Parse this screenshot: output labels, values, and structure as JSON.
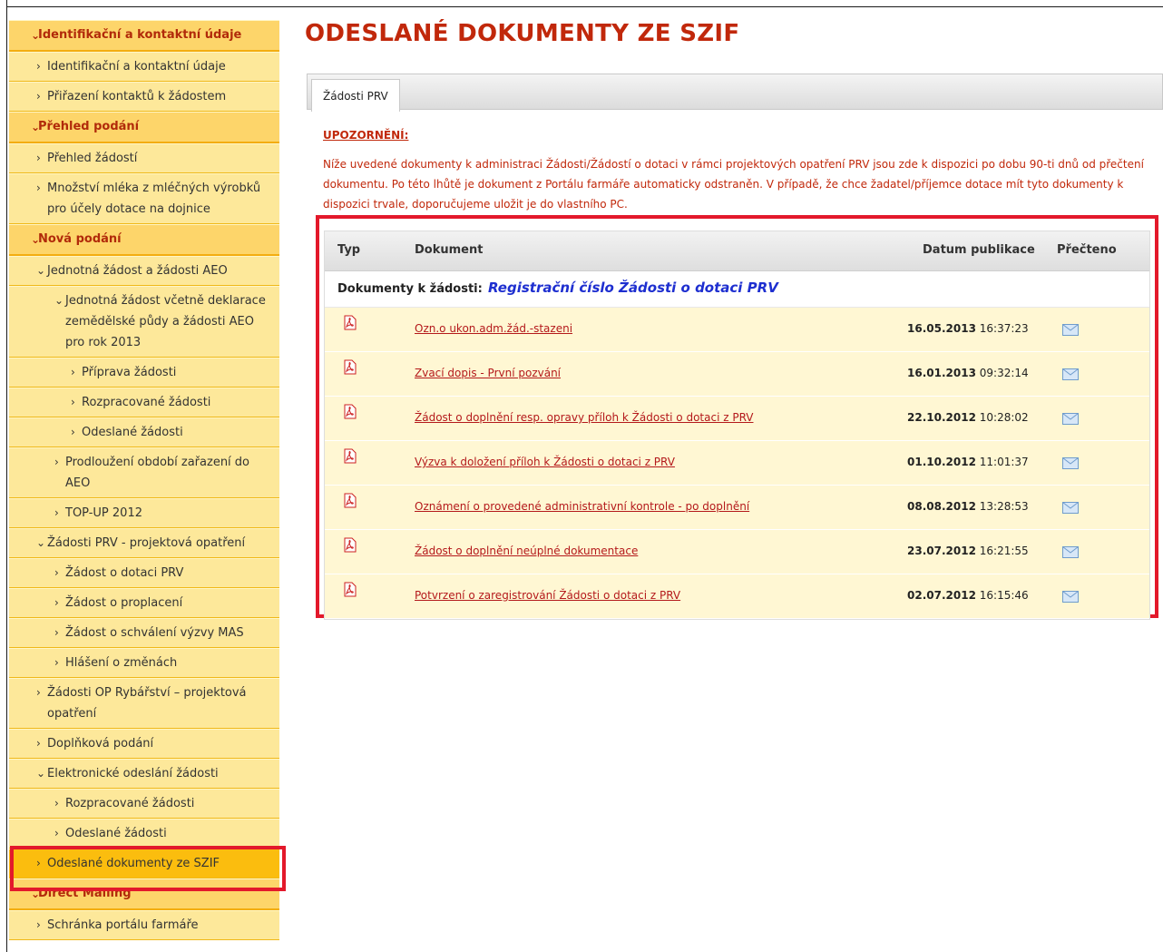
{
  "sidebar": {
    "items": [
      {
        "label": "Identifikační a kontaktní údaje"
      },
      {
        "label": "Identifikační a kontaktní údaje"
      },
      {
        "label": "Přiřazení kontaktů k žádostem"
      },
      {
        "label": "Přehled podání"
      },
      {
        "label": "Přehled žádostí"
      },
      {
        "label": "Množství mléka z mléčných výrobků pro účely dotace na dojnice"
      },
      {
        "label": "Nová podání"
      },
      {
        "label": "Jednotná žádost a žádosti AEO"
      },
      {
        "label": "Jednotná žádost včetně deklarace zemědělské půdy a žádosti AEO pro rok 2013"
      },
      {
        "label": "Příprava žádosti"
      },
      {
        "label": "Rozpracované žádosti"
      },
      {
        "label": "Odeslané žádosti"
      },
      {
        "label": "Prodloužení období zařazení do AEO"
      },
      {
        "label": "TOP-UP 2012"
      },
      {
        "label": "Žádosti PRV - projektová opatření"
      },
      {
        "label": "Žádost o dotaci PRV"
      },
      {
        "label": "Žádost o proplacení"
      },
      {
        "label": "Žádost o schválení výzvy MAS"
      },
      {
        "label": "Hlášení o změnách"
      },
      {
        "label": "Žádosti OP Rybářství – projektová opatření"
      },
      {
        "label": "Doplňková podání"
      },
      {
        "label": "Elektronické odeslání žádosti"
      },
      {
        "label": "Rozpracované žádosti"
      },
      {
        "label": "Odeslané žádosti"
      },
      {
        "label": "Odeslané dokumenty ze SZIF"
      },
      {
        "label": "Direct Mailing"
      },
      {
        "label": "Schránka portálu farmáře"
      }
    ]
  },
  "main": {
    "title": "ODESLANÉ DOKUMENTY ZE SZIF",
    "tab": "Žádosti PRV",
    "warning_title": "UPOZORNĚNÍ:",
    "warning_text": "Níže uvedené dokumenty k administraci Žádosti/Žádostí o dotaci v rámci projektových opatření PRV jsou zde k dispozici po dobu 90-ti dnů od přečtení dokumentu. Po této lhůtě je dokument z Portálu farmáře automaticky odstraněn. V případě, že chce žadatel/příjemce dotace mít tyto dokumenty k dispozici trvale, doporučujeme uložit je do vlastního PC."
  },
  "table": {
    "headers": {
      "type": "Typ",
      "document": "Dokument",
      "date": "Datum publikace",
      "read": "Přečteno"
    },
    "group_label": "Dokumenty k žádosti:",
    "group_link": "Registrační číslo Žádosti o dotaci PRV",
    "rows": [
      {
        "document": "Ozn.o ukon.adm.žád.-stazeni",
        "date": "16.05.2013",
        "time": "16:37:23"
      },
      {
        "document": "Zvací dopis - První pozvání",
        "date": "16.01.2013",
        "time": "09:32:14"
      },
      {
        "document": "Žádost o doplnění resp. opravy příloh k Žádosti o dotaci z PRV",
        "date": "22.10.2012",
        "time": "10:28:02"
      },
      {
        "document": "Výzva k doložení příloh k Žádosti o dotaci z PRV",
        "date": "01.10.2012",
        "time": "11:01:37"
      },
      {
        "document": "Oznámení o provedené administrativní kontrole - po doplnění",
        "date": "08.08.2012",
        "time": "13:28:53"
      },
      {
        "document": "Žádost o doplnění neúplné dokumentace",
        "date": "23.07.2012",
        "time": "16:21:55"
      },
      {
        "document": "Potvrzení o zaregistrování Žádosti o dotaci z PRV",
        "date": "02.07.2012",
        "time": "16:15:46"
      }
    ]
  },
  "colors": {
    "accent_red": "#c1280b",
    "highlight_red": "#e3192b",
    "menu_yellow": "#fde89a",
    "menu_active": "#fbbd0e",
    "link_blue": "#1e2fd0"
  }
}
